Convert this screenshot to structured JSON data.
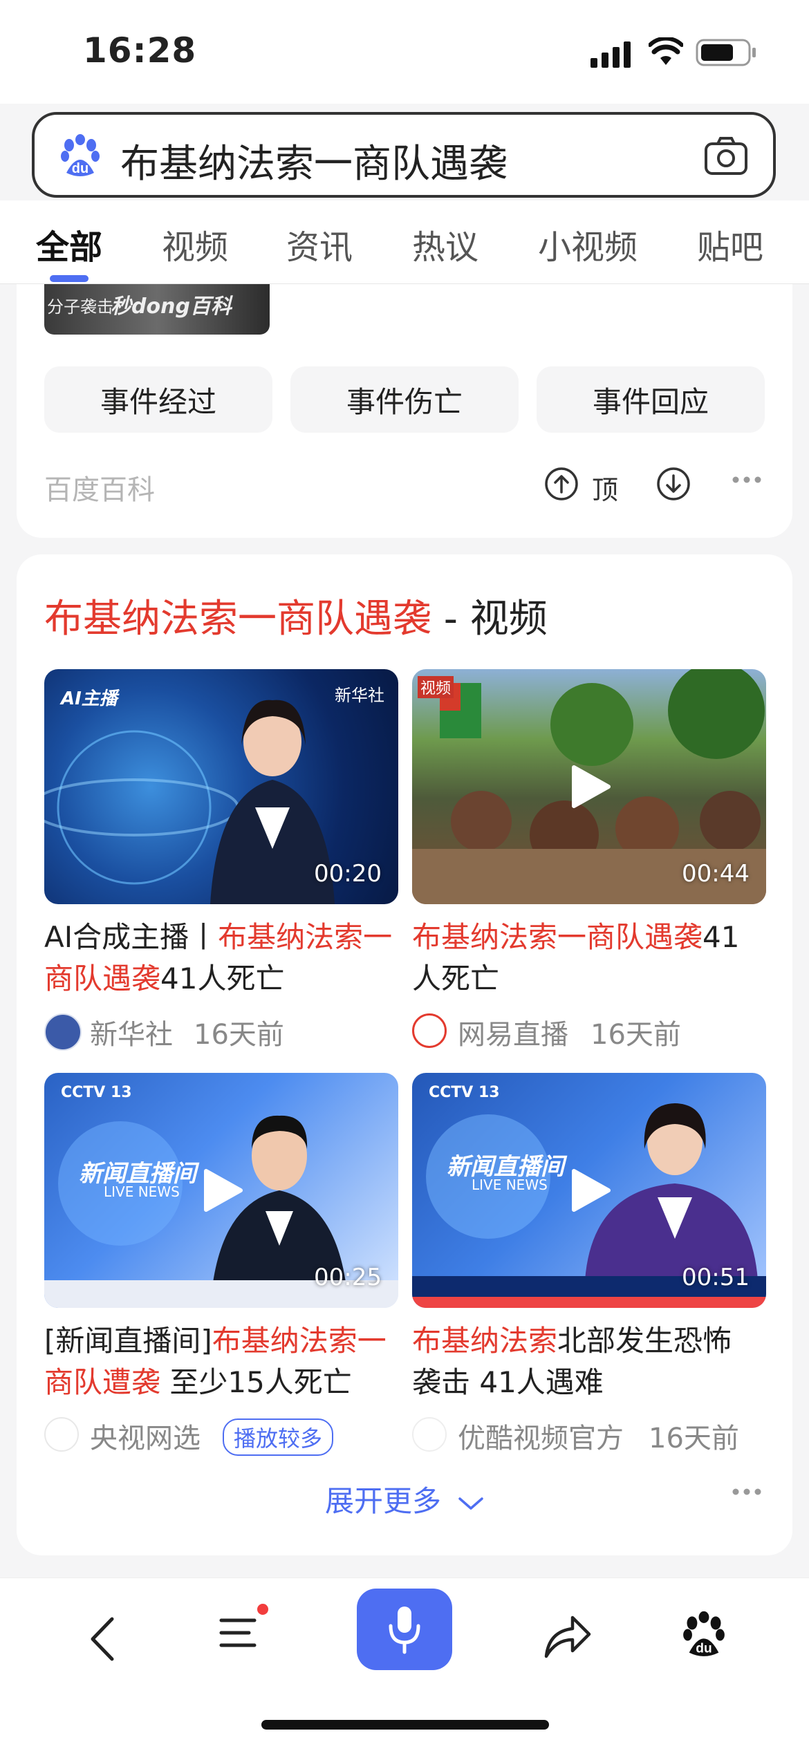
{
  "status_bar": {
    "time": "16:28"
  },
  "search": {
    "query": "布基纳法索一商队遇袭"
  },
  "tabs": [
    "全部",
    "视频",
    "资讯",
    "热议",
    "小视频",
    "贴吧"
  ],
  "baike_card": {
    "thumb_text_1": "分子袭击",
    "thumb_text_2": "秒dong百科",
    "chips": [
      "事件经过",
      "事件伤亡",
      "事件回应"
    ],
    "source": "百度百科",
    "vote_label": "顶"
  },
  "video_card": {
    "title_highlight": "布基纳法索一商队遇袭",
    "title_suffix": " - 视频",
    "videos": [
      {
        "duration": "00:20",
        "title_pre": "AI合成主播丨",
        "title_hl": "布基纳法索一商队遇袭",
        "title_post": "41人死亡",
        "publisher": "新华社",
        "time": "16天前",
        "badge": "",
        "overlay_1": "AI主播",
        "overlay_2": "新华社"
      },
      {
        "duration": "00:44",
        "title_pre": "",
        "title_hl": "布基纳法索一商队遇袭",
        "title_post": "41人死亡",
        "publisher": "网易直播",
        "time": "16天前",
        "badge": "",
        "overlay_1": "视频",
        "overlay_2": ""
      },
      {
        "duration": "00:25",
        "title_pre": "[新闻直播间]",
        "title_hl": "布基纳法索一商队遭袭",
        "title_post": " 至少15人死亡",
        "publisher": "央视网选",
        "time": "",
        "badge": "播放较多",
        "overlay_1": "新闻直播间",
        "overlay_2": "LIVE NEWS"
      },
      {
        "duration": "00:51",
        "title_pre": "",
        "title_hl": "布基纳法索",
        "title_post": "北部发生恐怖袭击 41人遇难",
        "publisher": "优酷视频官方",
        "time": "16天前",
        "badge": "",
        "overlay_1": "新闻直播间",
        "overlay_2": "LIVE NEWS"
      }
    ],
    "expand_label": "展开更多"
  },
  "colors": {
    "accent": "#4e6ef2",
    "highlight": "#e33a2e"
  }
}
